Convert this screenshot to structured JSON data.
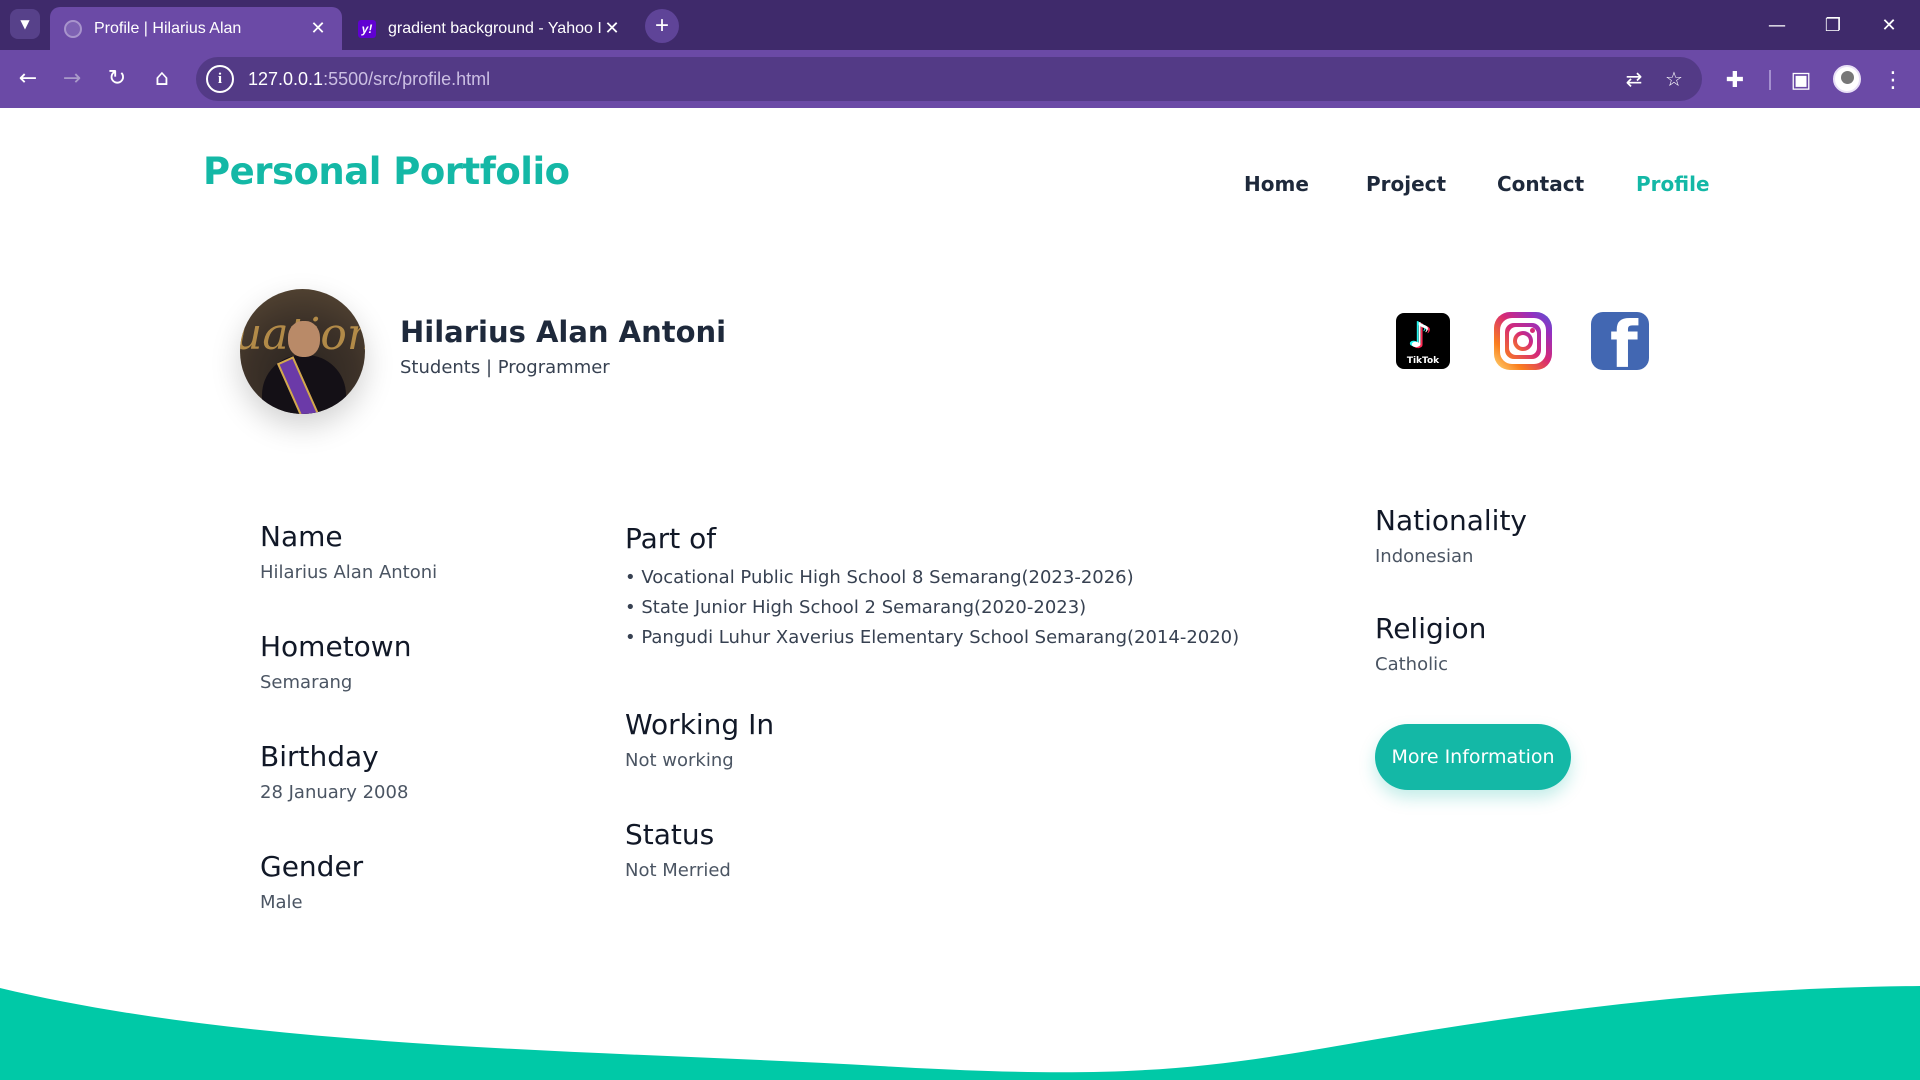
{
  "browser": {
    "tabs": [
      {
        "title": "Profile | Hilarius Alan",
        "active": true
      },
      {
        "title": "gradient background - Yahoo I",
        "active": false
      }
    ],
    "favicon_yahoo": "y!",
    "new_tab": "+",
    "url_host": "127.0.0.1",
    "url_rest": ":5500/src/profile.html",
    "info_glyph": "i",
    "colors": {
      "tabstrip": "#3f2a6b",
      "toolbar": "#6b4aa6",
      "omnibox": "#533a86"
    }
  },
  "site": {
    "brand": "Personal Portfolio",
    "nav": [
      {
        "label": "Home",
        "active": false
      },
      {
        "label": "Project",
        "active": false
      },
      {
        "label": "Contact",
        "active": false
      },
      {
        "label": "Profile",
        "active": true
      }
    ],
    "accent_color": "#14b8a6"
  },
  "profile": {
    "name": "Hilarius Alan Antoni",
    "role": "Students | Programmer",
    "photo_text": "uation"
  },
  "social": {
    "tiktok_label": "TikTok",
    "icons": [
      "tiktok-icon",
      "instagram-icon",
      "facebook-icon"
    ]
  },
  "info": {
    "name_label": "Name",
    "name_value": "Hilarius Alan Antoni",
    "hometown_label": "Hometown",
    "hometown_value": "Semarang",
    "birthday_label": "Birthday",
    "birthday_value": "28 January 2008",
    "gender_label": "Gender",
    "gender_value": "Male",
    "part_of_label": "Part of",
    "part_of_items": [
      "• Vocational Public High School 8 Semarang(2023-2026)",
      "• State Junior High School 2 Semarang(2020-2023)",
      "• Pangudi Luhur Xaverius Elementary School Semarang(2014-2020)"
    ],
    "working_label": "Working In",
    "working_value": "Not working",
    "status_label": "Status",
    "status_value": "Not Merried",
    "nationality_label": "Nationality",
    "nationality_value": "Indonesian",
    "religion_label": "Religion",
    "religion_value": "Catholic"
  },
  "more_button": "More Information"
}
